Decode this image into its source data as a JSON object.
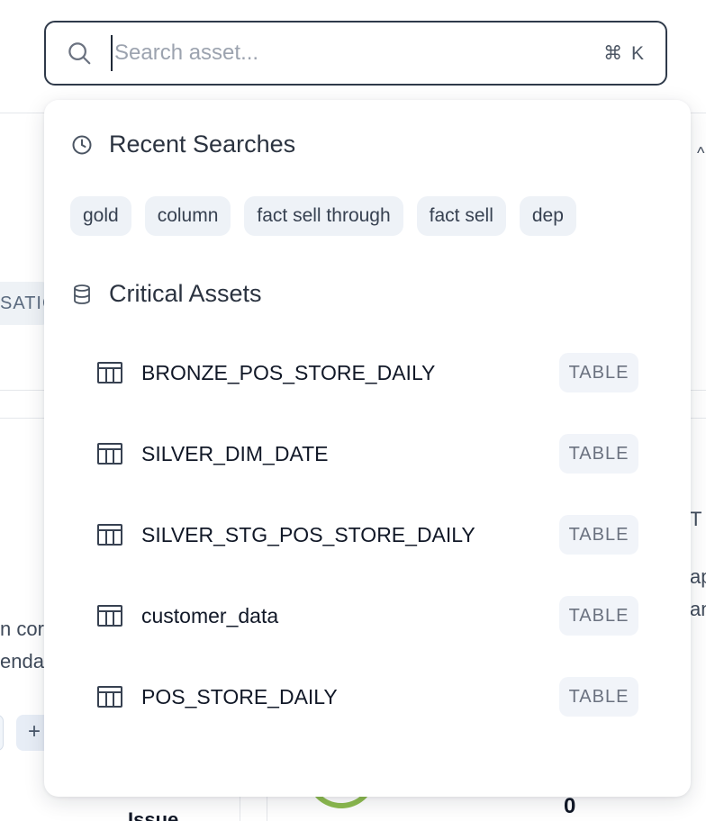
{
  "search": {
    "placeholder": "Search asset...",
    "value": "",
    "shortcut": "⌘ K",
    "icon": "search-icon"
  },
  "recent": {
    "title": "Recent Searches",
    "icon": "clock-icon",
    "items": [
      "gold",
      "column",
      "fact sell through",
      "fact sell",
      "dep"
    ]
  },
  "critical": {
    "title": "Critical Assets",
    "icon": "database-icon",
    "items": [
      {
        "name": "BRONZE_POS_STORE_DAILY",
        "type": "TABLE",
        "icon": "table-icon"
      },
      {
        "name": "SILVER_DIM_DATE",
        "type": "TABLE",
        "icon": "table-icon"
      },
      {
        "name": "SILVER_STG_POS_STORE_DAILY",
        "type": "TABLE",
        "icon": "table-icon"
      },
      {
        "name": "customer_data",
        "type": "TABLE",
        "icon": "table-icon"
      },
      {
        "name": "POS_STORE_DAILY",
        "type": "TABLE",
        "icon": "table-icon"
      }
    ]
  },
  "background": {
    "chip_left": "SATIC",
    "text_left_1": "n cor",
    "text_left_2": "enda",
    "plus": "+",
    "text_bottom": "Issue",
    "zero": "0",
    "text_right_1": "T",
    "text_right_2": "ap",
    "text_right_3": "an"
  },
  "colors": {
    "border": "#2f3a4a",
    "chip_bg": "#eef2f7",
    "badge_bg": "#f1f4f9",
    "ring": "#8dbb4f"
  }
}
